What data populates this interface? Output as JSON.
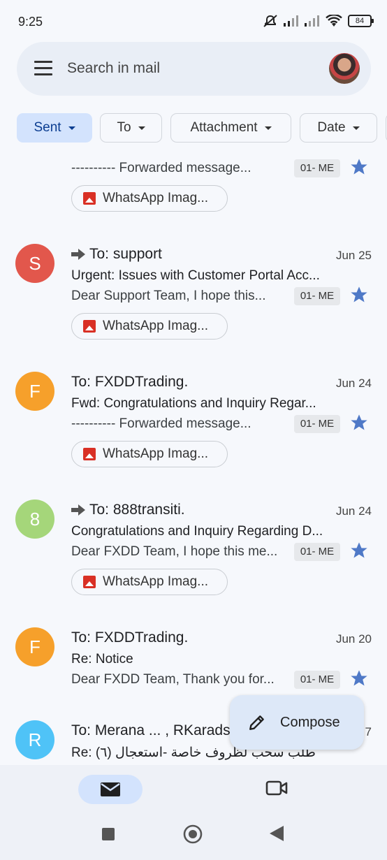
{
  "status": {
    "time": "9:25",
    "battery": "84"
  },
  "search": {
    "placeholder": "Search in mail"
  },
  "chips": [
    {
      "label": "Sent"
    },
    {
      "label": "To"
    },
    {
      "label": "Attachment"
    },
    {
      "label": "Date"
    }
  ],
  "emails": [
    {
      "snippet": "---------- Forwarded message...",
      "label": "01- ME",
      "attachment": "WhatsApp Imag..."
    },
    {
      "avatar_letter": "S",
      "avatar_color": "#e2574c",
      "sender": "To: support",
      "date": "Jun 25",
      "subject": "Urgent: Issues with Customer Portal Acc...",
      "snippet": "Dear Support Team, I hope this...",
      "label": "01- ME",
      "attachment": "WhatsApp Imag..."
    },
    {
      "avatar_letter": "F",
      "avatar_color": "#f6a02b",
      "sender": "To: FXDDTrading.",
      "date": "Jun 24",
      "subject": "Fwd: Congratulations and Inquiry Regar...",
      "snippet": "---------- Forwarded message...",
      "label": "01- ME",
      "attachment": "WhatsApp Imag..."
    },
    {
      "avatar_letter": "8",
      "avatar_color": "#a5d67a",
      "sender": "To: 888transiti.",
      "date": "Jun 24",
      "subject": "Congratulations and Inquiry Regarding D...",
      "snippet": "Dear FXDD Team, I hope this me...",
      "label": "01- ME",
      "attachment": "WhatsApp Imag..."
    },
    {
      "avatar_letter": "F",
      "avatar_color": "#f6a02b",
      "sender": "To: FXDDTrading.",
      "date": "Jun 20",
      "subject": "Re: Notice",
      "snippet": "Dear FXDD Team, Thank you for...",
      "label": "01- ME"
    },
    {
      "avatar_letter": "R",
      "avatar_color": "#4fc3f7",
      "sender": "To: Merana ... , RKarads",
      "date": "7",
      "subject": "Re: طلب سحب لظروف خاصة -استعجال (٦)"
    }
  ],
  "compose": {
    "label": "Compose"
  },
  "colors": {
    "accent": "#d3e3fd",
    "star": "#4f79c7"
  }
}
